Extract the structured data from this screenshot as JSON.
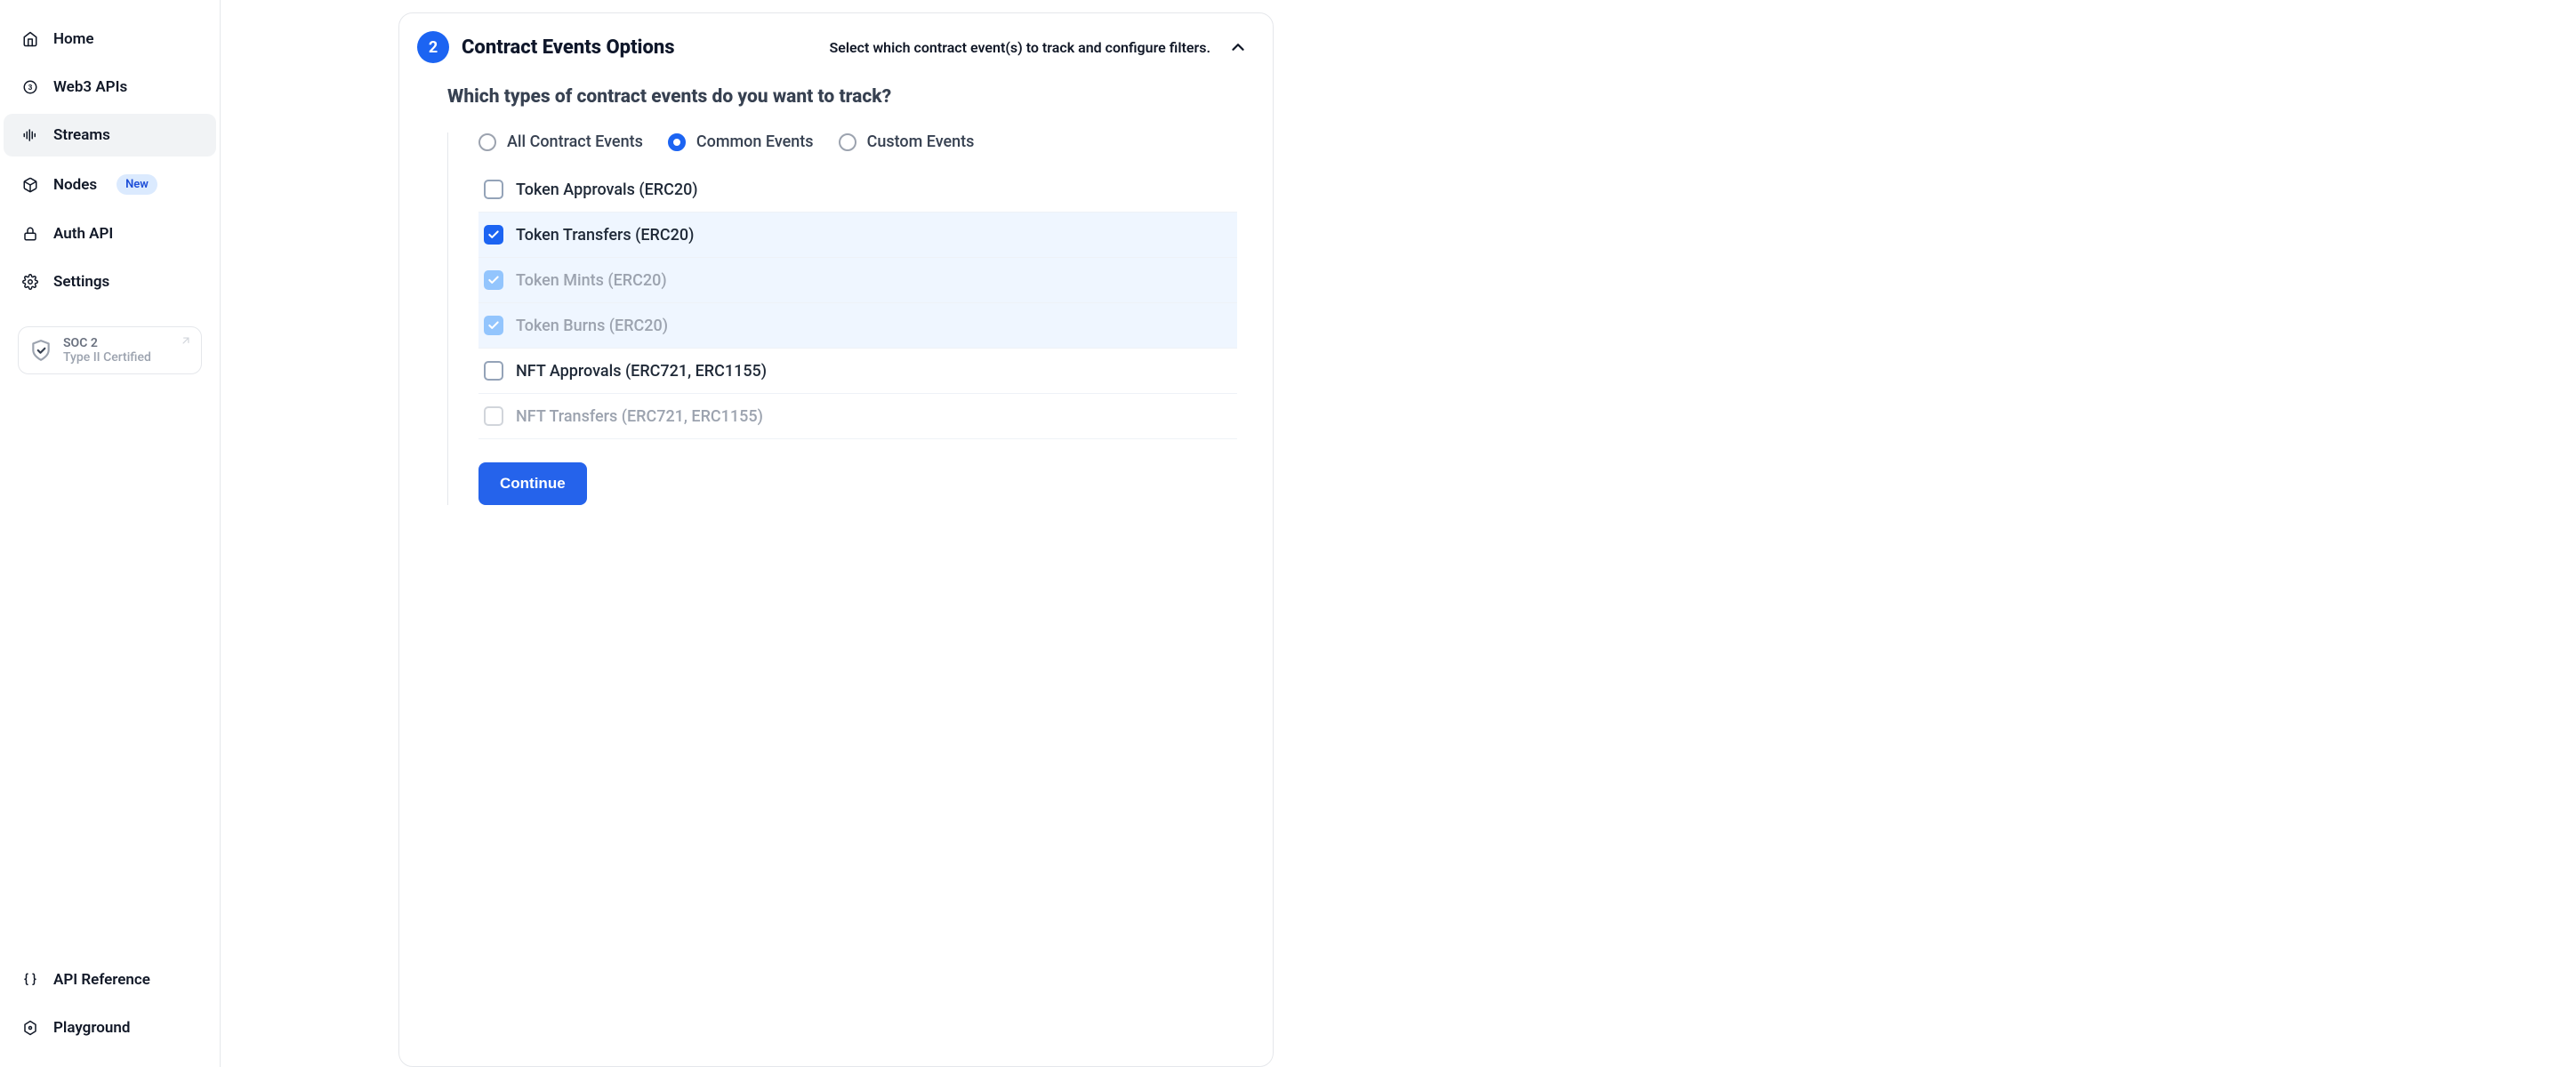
{
  "sidebar": {
    "items": [
      {
        "label": "Home"
      },
      {
        "label": "Web3 APIs"
      },
      {
        "label": "Streams"
      },
      {
        "label": "Nodes",
        "badge": "New"
      },
      {
        "label": "Auth API"
      },
      {
        "label": "Settings"
      }
    ],
    "soc": {
      "line1": "SOC 2",
      "line2": "Type II Certified"
    },
    "bottom": [
      {
        "label": "API Reference"
      },
      {
        "label": "Playground"
      }
    ]
  },
  "panel": {
    "step_number": "2",
    "title": "Contract Events Options",
    "hint": "Select which contract event(s) to track and configure filters.",
    "question": "Which types of contract events do you want to track?",
    "radios": [
      {
        "label": "All Contract Events",
        "selected": false
      },
      {
        "label": "Common Events",
        "selected": true
      },
      {
        "label": "Custom Events",
        "selected": false
      }
    ],
    "checkboxes": [
      {
        "label": "Token Approvals (ERC20)",
        "checked": false,
        "disabled": false
      },
      {
        "label": "Token Transfers (ERC20)",
        "checked": true,
        "disabled": false
      },
      {
        "label": "Token Mints (ERC20)",
        "checked": true,
        "disabled": true
      },
      {
        "label": "Token Burns (ERC20)",
        "checked": true,
        "disabled": true
      },
      {
        "label": "NFT Approvals (ERC721, ERC1155)",
        "checked": false,
        "disabled": false
      },
      {
        "label": "NFT Transfers (ERC721, ERC1155)",
        "checked": false,
        "disabled": true
      }
    ],
    "continue_label": "Continue"
  }
}
